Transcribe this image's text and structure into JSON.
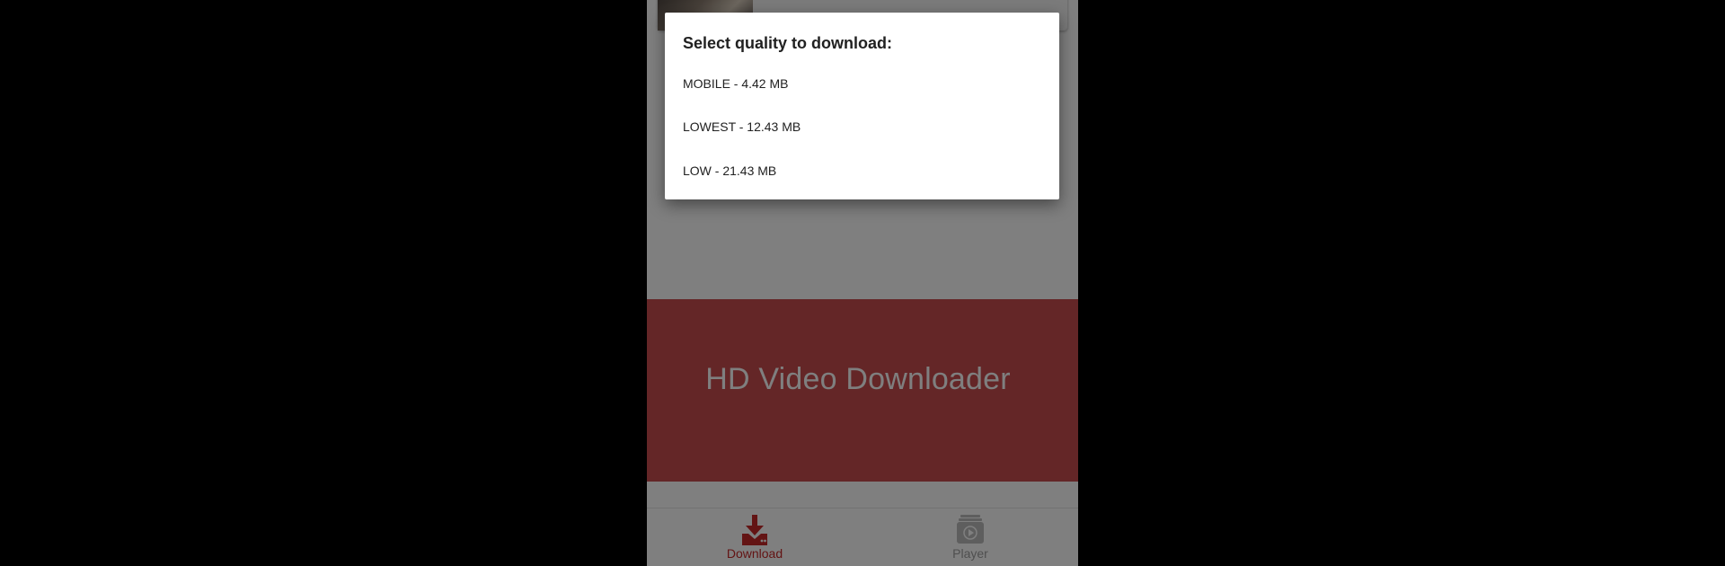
{
  "dialog": {
    "title": "Select quality to download:",
    "options": [
      {
        "label": "MOBILE - 4.42 MB"
      },
      {
        "label": "LOWEST - 12.43 MB"
      },
      {
        "label": "LOW - 21.43 MB"
      }
    ]
  },
  "promo": {
    "title": "HD Video Downloader",
    "background_color": "#c94c4f"
  },
  "bottom_nav": {
    "items": [
      {
        "label": "Download",
        "icon": "download-tray-icon",
        "active": true,
        "color": "#c62828"
      },
      {
        "label": "Player",
        "icon": "video-player-icon",
        "active": false,
        "color": "#9e9e9e"
      }
    ]
  },
  "colors": {
    "accent": "#c62828",
    "scrim": "rgba(0,0,0,0.5)"
  }
}
